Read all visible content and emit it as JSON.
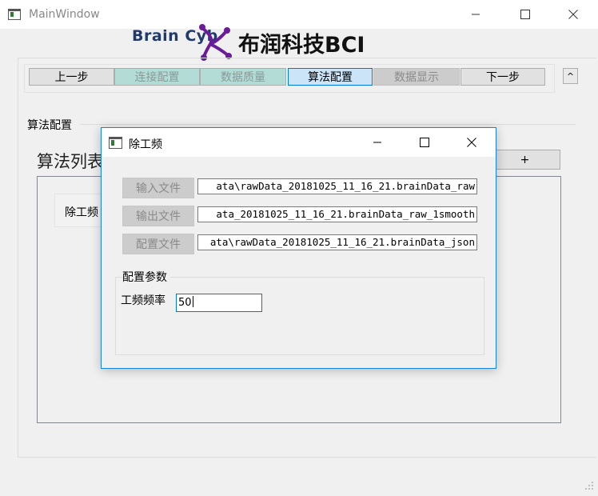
{
  "window": {
    "title": "MainWindow"
  },
  "logo": {
    "text": "Brain Cyb",
    "title": "布润科技BCI"
  },
  "steps": [
    {
      "label": "上一步",
      "state": "normal"
    },
    {
      "label": "连接配置",
      "state": "done"
    },
    {
      "label": "数据质量",
      "state": "done"
    },
    {
      "label": "算法配置",
      "state": "active"
    },
    {
      "label": "数据显示",
      "state": "disabled"
    },
    {
      "label": "下一步",
      "state": "normal"
    }
  ],
  "collapse_label": "^",
  "algo_section": {
    "label": "算法配置",
    "list_heading": "算法列表",
    "add_label": "+",
    "items": [
      "除工频"
    ]
  },
  "dialog": {
    "title": "除工频",
    "files": [
      {
        "button": "输入文件",
        "value": "ata\\rawData_20181025_11_16_21.brainData_raw"
      },
      {
        "button": "输出文件",
        "value": "ata_20181025_11_16_21.brainData_raw_1smooth"
      },
      {
        "button": "配置文件",
        "value": "ata\\rawData_20181025_11_16_21.brainData_json"
      }
    ],
    "params": {
      "label": "配置参数",
      "name": "工频频率",
      "value": "50"
    }
  },
  "colors": {
    "step_done": "#b3dcd6",
    "step_active": "#cce4f7",
    "dialog_border": "#1883d7",
    "logo_purple": "#6a1b9a",
    "logo_blue": "#1f3a6b"
  }
}
